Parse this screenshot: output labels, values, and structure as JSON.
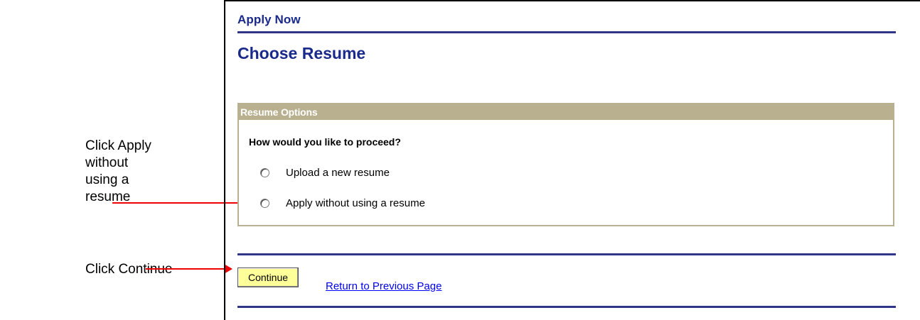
{
  "annotations": {
    "apply_note": "Click Apply without using a resume",
    "continue_note": "Click Continue",
    "arrow_color": "#ee0000"
  },
  "page": {
    "breadcrumb": "Apply Now",
    "title": "Choose Resume",
    "accent_color": "#1a2a8a"
  },
  "resume_options": {
    "header": "Resume Options",
    "question": "How would you like to proceed?",
    "options": [
      {
        "label": "Upload a new resume",
        "selected": false
      },
      {
        "label": "Apply without using a resume",
        "selected": false
      }
    ]
  },
  "actions": {
    "continue_label": "Continue",
    "return_link": "Return to Previous Page"
  }
}
